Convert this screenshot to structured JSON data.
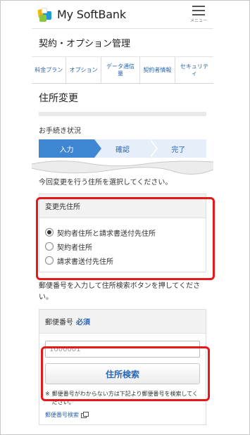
{
  "header": {
    "brand": "My SoftBank",
    "menu_label": "メニュー"
  },
  "page_title": "契約・オプション管理",
  "tabs": [
    {
      "label": "料金プラン"
    },
    {
      "label": "オプション"
    },
    {
      "label": "データ通信量"
    },
    {
      "label": "契約者情報"
    },
    {
      "label": "セキュリティ"
    }
  ],
  "section_heading": "住所変更",
  "status": {
    "label": "お手続き状況",
    "steps": [
      {
        "label": "入力",
        "active": true
      },
      {
        "label": "確認",
        "active": false
      },
      {
        "label": "完了",
        "active": false
      }
    ]
  },
  "address_select": {
    "instruction": "今回変更を行う住所を選択してください。",
    "box_title": "変更先住所",
    "options": [
      {
        "label": "契約者住所と請求書送付先住所",
        "selected": true
      },
      {
        "label": "契約者住所",
        "selected": false
      },
      {
        "label": "請求書送付先住所",
        "selected": false
      }
    ]
  },
  "zip": {
    "instruction": "郵便番号を入力して住所検索ボタンを押してください。",
    "box_title": "郵便番号",
    "required_label": "必須",
    "placeholder": "1000001",
    "search_button": "住所検索",
    "note_mark": "※",
    "note": "郵便番号がわからない方は下記より郵便番号を検索してください。",
    "lookup_link": "郵便番号検索"
  },
  "colors": {
    "accent": "#2a66b2",
    "step_active": "#3f86d3",
    "highlight": "#e5191c"
  }
}
